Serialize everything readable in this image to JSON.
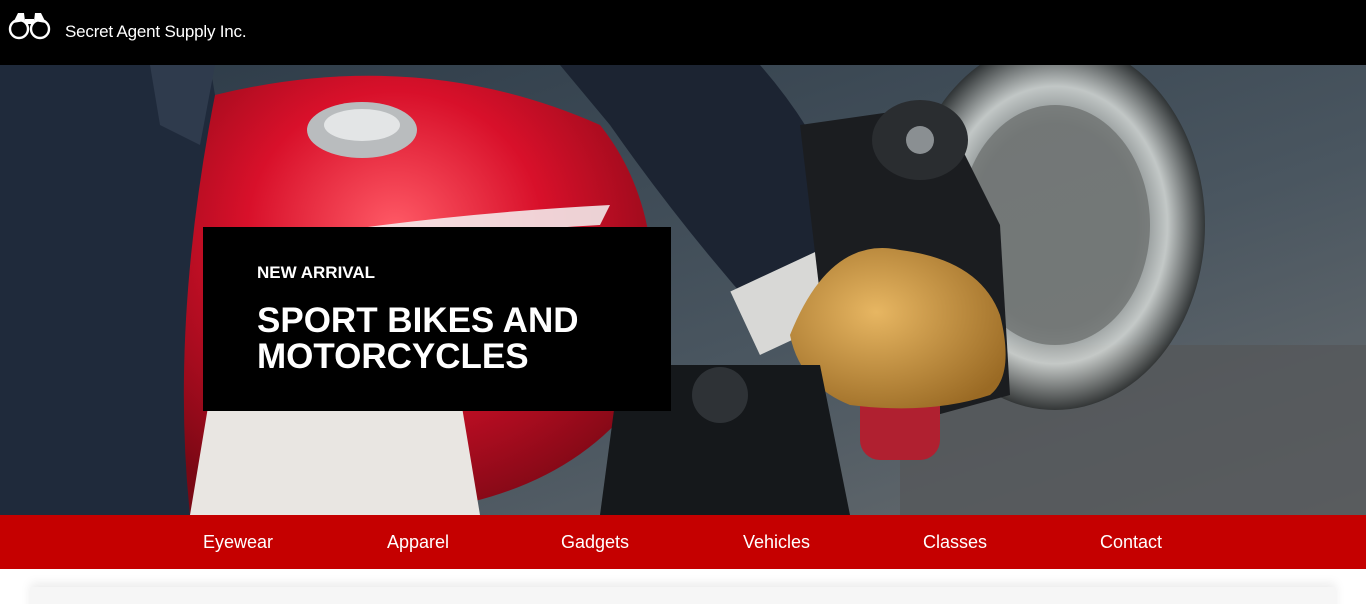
{
  "header": {
    "logo_icon": "binoculars-icon",
    "title": "Secret Agent Supply Inc."
  },
  "hero": {
    "image": "motorcycle-rider-photo",
    "kicker": "NEW ARRIVAL",
    "headline": "SPORT BIKES AND MOTORCYCLES"
  },
  "nav": {
    "items": [
      {
        "label": "Eyewear"
      },
      {
        "label": "Apparel"
      },
      {
        "label": "Gadgets"
      },
      {
        "label": "Vehicles"
      },
      {
        "label": "Classes"
      },
      {
        "label": "Contact"
      }
    ]
  },
  "colors": {
    "topbar": "#000000",
    "nav": "#c50000",
    "card": "#000000",
    "text": "#ffffff"
  }
}
